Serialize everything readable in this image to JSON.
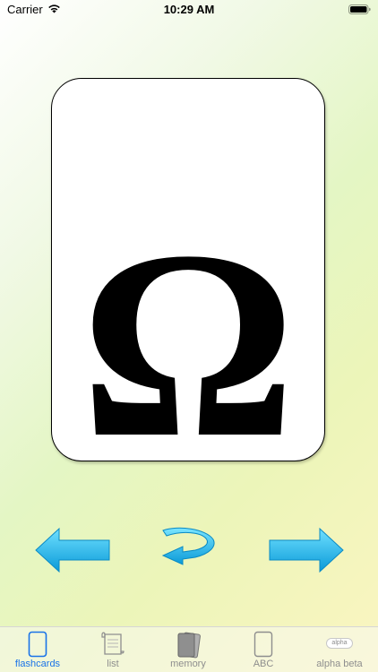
{
  "status_bar": {
    "carrier": "Carrier",
    "time": "10:29 AM"
  },
  "card": {
    "letter": "Ω"
  },
  "controls": {
    "prev_icon": "arrow-left-icon",
    "flip_icon": "flip-arrow-icon",
    "next_icon": "arrow-right-icon"
  },
  "tab_bar": {
    "active_color": "#1a73e8",
    "inactive_color": "#8e8e8e",
    "tabs": [
      {
        "label": "flashcards"
      },
      {
        "label": "list"
      },
      {
        "label": "memory"
      },
      {
        "label": "ABC"
      },
      {
        "label": "alpha beta",
        "icon_text": "alpha"
      }
    ]
  }
}
